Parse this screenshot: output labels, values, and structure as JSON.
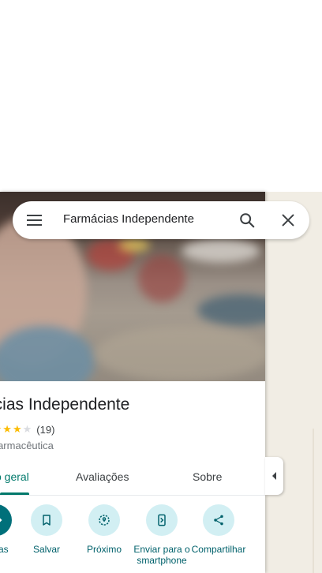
{
  "search": {
    "query": "Farmácias Independente"
  },
  "place": {
    "title": "Farmácias Independente",
    "stars": "★★★★",
    "empty_star": "★",
    "rating_value": 4,
    "review_count": "(19)",
    "category": "Drogaria farmacêutica"
  },
  "tabs": [
    {
      "label": "Visão geral",
      "active": true
    },
    {
      "label": "Avaliações",
      "active": false
    },
    {
      "label": "Sobre",
      "active": false
    }
  ],
  "actions": [
    {
      "label": "Rotas",
      "icon": "directions-icon"
    },
    {
      "label": "Salvar",
      "icon": "bookmark-icon"
    },
    {
      "label": "Próximo",
      "icon": "nearby-icon"
    },
    {
      "label": "Enviar para o smartphone",
      "icon": "send-to-phone-icon"
    },
    {
      "label": "Compartilhar",
      "icon": "share-icon"
    }
  ],
  "colors": {
    "accent": "#00796b",
    "action_circle": "#d2eff3",
    "star": "#fbbc04"
  }
}
